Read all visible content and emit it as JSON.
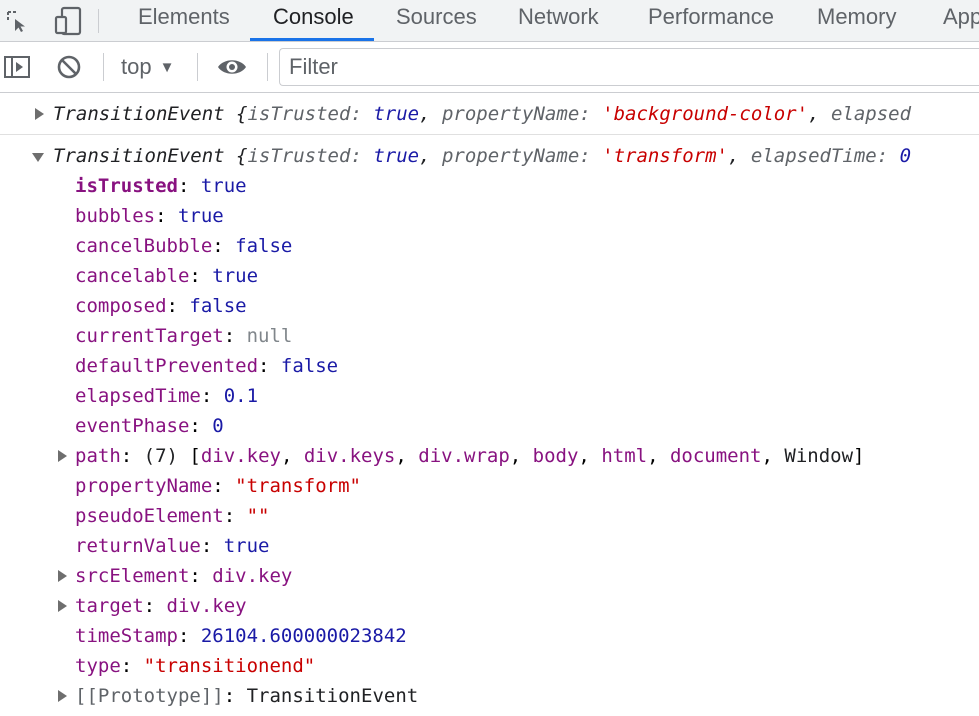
{
  "tabs": [
    "Elements",
    "Console",
    "Sources",
    "Network",
    "Performance",
    "Memory",
    "Application"
  ],
  "active_tab": "Console",
  "toolbar": {
    "context": "top",
    "filter_placeholder": "Filter"
  },
  "colors": {
    "accent": "#1a73e8"
  },
  "icons": {
    "inspect": "inspect-element-icon",
    "device": "device-toolbar-icon",
    "sidebar": "show-sidebar-icon",
    "clear": "clear-console-icon",
    "live": "eye-icon"
  },
  "console": {
    "collapsed_entry": {
      "class_name": "TransitionEvent",
      "open": " {",
      "k1": "isTrusted",
      "v1": "true",
      "k2": "propertyName",
      "v2": "'background-color'",
      "k3": "elapsed"
    },
    "expanded_entry": {
      "class_name": "TransitionEvent",
      "open": " {",
      "k1": "isTrusted",
      "v1": "true",
      "k2": "propertyName",
      "v2": "'transform'",
      "k3": "elapsedTime",
      "v3": "0"
    },
    "props": [
      {
        "key": "isTrusted",
        "value": "true"
      },
      {
        "key": "bubbles",
        "value": "true"
      },
      {
        "key": "cancelBubble",
        "value": "false"
      },
      {
        "key": "cancelable",
        "value": "true"
      },
      {
        "key": "composed",
        "value": "false"
      },
      {
        "key": "currentTarget",
        "value": "null"
      },
      {
        "key": "defaultPrevented",
        "value": "false"
      },
      {
        "key": "elapsedTime",
        "value": "0.1"
      },
      {
        "key": "eventPhase",
        "value": "0"
      },
      {
        "key": "path",
        "count": "(7)",
        "items": [
          "div.key",
          "div.keys",
          "div.wrap",
          "body",
          "html",
          "document",
          "Window"
        ]
      },
      {
        "key": "propertyName",
        "value": "\"transform\""
      },
      {
        "key": "pseudoElement",
        "value": "\"\""
      },
      {
        "key": "returnValue",
        "value": "true"
      },
      {
        "key": "srcElement",
        "value": "div.key"
      },
      {
        "key": "target",
        "value": "div.key"
      },
      {
        "key": "timeStamp",
        "value": "26104.600000023842"
      },
      {
        "key": "type",
        "value": "\"transitionend\""
      },
      {
        "key": "[[Prototype]]",
        "value": "TransitionEvent"
      }
    ]
  }
}
